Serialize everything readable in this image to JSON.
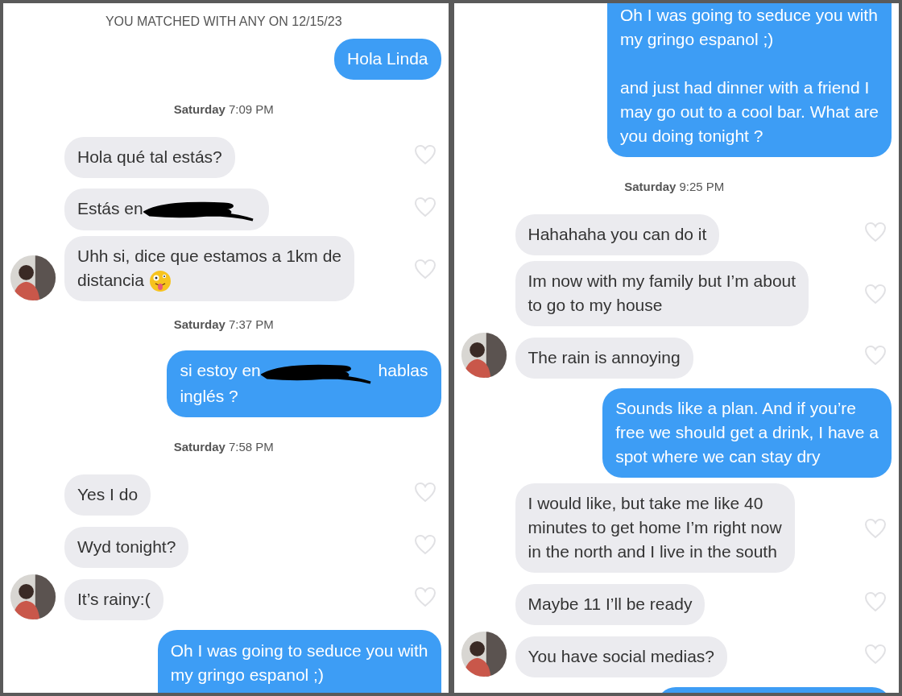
{
  "panels": [
    {
      "items": [
        {
          "kind": "notice",
          "text": "YOU MATCHED WITH ANY ON 12/15/23"
        },
        {
          "kind": "sent",
          "segments": [
            {
              "kind": "text",
              "text": "Hola Linda"
            }
          ]
        },
        {
          "kind": "timestamp",
          "text": "**Saturday** 7:09 PM"
        },
        {
          "kind": "received",
          "avatar": false,
          "segments": [
            {
              "kind": "text",
              "text": "Hola qué tal estás?"
            }
          ]
        },
        {
          "kind": "received",
          "avatar": false,
          "segments": [
            {
              "kind": "text",
              "text": "Estás en"
            },
            {
              "kind": "redaction"
            }
          ]
        },
        {
          "kind": "received",
          "avatar": true,
          "segments": [
            {
              "kind": "text",
              "text": "Uhh si, dice que estamos a 1km de\ndistancia"
            },
            {
              "kind": "emoji"
            }
          ]
        },
        {
          "kind": "timestamp",
          "text": "**Saturday** 7:37 PM"
        },
        {
          "kind": "sent",
          "segments": [
            {
              "kind": "text",
              "text": "si estoy en"
            },
            {
              "kind": "redaction"
            },
            {
              "kind": "text",
              "text": "hablas\ninglés ?"
            }
          ]
        },
        {
          "kind": "timestamp",
          "text": "**Saturday** 7:58 PM"
        },
        {
          "kind": "received",
          "avatar": false,
          "segments": [
            {
              "kind": "text",
              "text": "Yes I do"
            }
          ]
        },
        {
          "kind": "received",
          "avatar": false,
          "segments": [
            {
              "kind": "text",
              "text": "Wyd tonight?"
            }
          ]
        },
        {
          "kind": "received",
          "avatar": true,
          "segments": [
            {
              "kind": "text",
              "text": "It’s rainy:("
            }
          ]
        },
        {
          "kind": "sent",
          "clipped_bottom": true,
          "segments": [
            {
              "kind": "text",
              "text": "Oh I was going to seduce you with\nmy gringo espanol ;)"
            }
          ]
        }
      ]
    },
    {
      "items": [
        {
          "kind": "sent",
          "clipped_top": true,
          "segments": [
            {
              "kind": "text",
              "text": "Oh I was going to seduce you with\nmy gringo espanol ;)\n\nand just had dinner with a friend I\nmay go out to a cool bar. What are\nyou doing tonight ?"
            }
          ]
        },
        {
          "kind": "timestamp",
          "text": "**Saturday** 9:25 PM"
        },
        {
          "kind": "received",
          "avatar": false,
          "segments": [
            {
              "kind": "text",
              "text": "Hahahaha you can do it"
            }
          ]
        },
        {
          "kind": "received",
          "avatar": false,
          "segments": [
            {
              "kind": "text",
              "text": "Im now with my family but I’m about\nto go to my house"
            }
          ]
        },
        {
          "kind": "received",
          "avatar": true,
          "segments": [
            {
              "kind": "text",
              "text": "The rain is annoying"
            }
          ]
        },
        {
          "kind": "sent",
          "segments": [
            {
              "kind": "text",
              "text": "Sounds like a plan. And if you’re\nfree we should get a drink, I have a\nspot where we can stay dry"
            }
          ]
        },
        {
          "kind": "received",
          "avatar": false,
          "segments": [
            {
              "kind": "text",
              "text": "I would like, but take me like 40\nminutes to get home I’m right now\nin the north and I live in the south"
            }
          ]
        },
        {
          "kind": "received",
          "avatar": false,
          "segments": [
            {
              "kind": "text",
              "text": "Maybe 11 I’ll be ready"
            }
          ]
        },
        {
          "kind": "received",
          "avatar": true,
          "segments": [
            {
              "kind": "text",
              "text": "You have social medias?"
            }
          ]
        },
        {
          "kind": "sent",
          "clipped_bottom": true
        }
      ]
    }
  ]
}
